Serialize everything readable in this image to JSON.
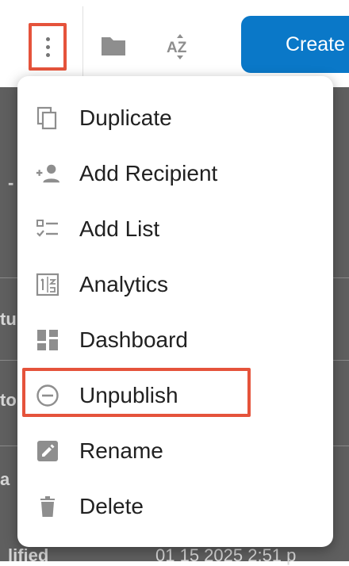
{
  "toolbar": {
    "create_label": "Create"
  },
  "background": {
    "row_fragments": [
      "tu",
      "to",
      "a",
      "lified"
    ],
    "date_fragment": "01 15 2025 2:51 p"
  },
  "menu": {
    "items": [
      {
        "label": "Duplicate",
        "icon": "duplicate-icon"
      },
      {
        "label": "Add Recipient",
        "icon": "add-person-icon"
      },
      {
        "label": "Add List",
        "icon": "checklist-icon"
      },
      {
        "label": "Analytics",
        "icon": "analytics-icon"
      },
      {
        "label": "Dashboard",
        "icon": "dashboard-icon"
      },
      {
        "label": "Unpublish",
        "icon": "remove-circle-icon"
      },
      {
        "label": "Rename",
        "icon": "edit-icon"
      },
      {
        "label": "Delete",
        "icon": "trash-icon"
      }
    ]
  },
  "colors": {
    "accent": "#0a78c8",
    "highlight": "#e5533b",
    "icon": "#757575",
    "text": "#212121"
  }
}
